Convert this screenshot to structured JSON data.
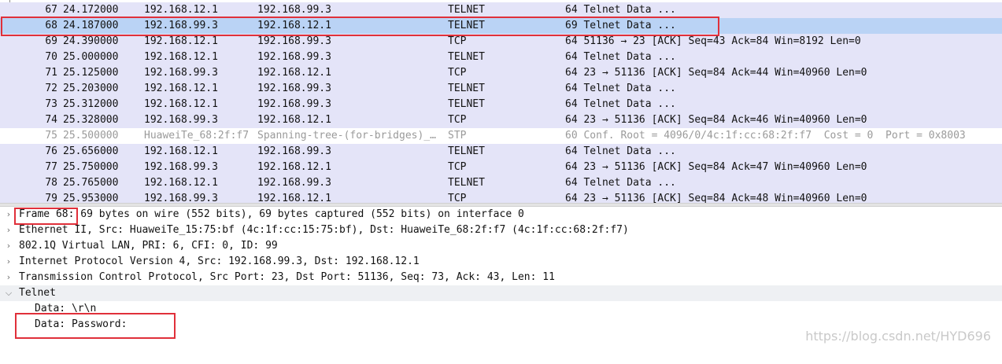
{
  "colors": {
    "row_telnet": "#e4e4f8",
    "row_tcp": "#e4e4f8",
    "row_stp": "#ffffff",
    "row_selected": "#bad3f5",
    "stp_text": "#9a9a9a",
    "highlight_box": "#e0303a"
  },
  "packets": [
    {
      "no": "67",
      "time": "24.172000",
      "src": "192.168.12.1",
      "dst": "192.168.99.3",
      "proto": "TELNET",
      "info": "64 Telnet Data ...",
      "kind": "telnet"
    },
    {
      "no": "68",
      "time": "24.187000",
      "src": "192.168.99.3",
      "dst": "192.168.12.1",
      "proto": "TELNET",
      "info": "69 Telnet Data ...",
      "kind": "selected"
    },
    {
      "no": "69",
      "time": "24.390000",
      "src": "192.168.12.1",
      "dst": "192.168.99.3",
      "proto": "TCP",
      "info": "64 51136 → 23 [ACK] Seq=43 Ack=84 Win=8192 Len=0",
      "kind": "tcp"
    },
    {
      "no": "70",
      "time": "25.000000",
      "src": "192.168.12.1",
      "dst": "192.168.99.3",
      "proto": "TELNET",
      "info": "64 Telnet Data ...",
      "kind": "telnet"
    },
    {
      "no": "71",
      "time": "25.125000",
      "src": "192.168.99.3",
      "dst": "192.168.12.1",
      "proto": "TCP",
      "info": "64 23 → 51136 [ACK] Seq=84 Ack=44 Win=40960 Len=0",
      "kind": "tcp"
    },
    {
      "no": "72",
      "time": "25.203000",
      "src": "192.168.12.1",
      "dst": "192.168.99.3",
      "proto": "TELNET",
      "info": "64 Telnet Data ...",
      "kind": "telnet"
    },
    {
      "no": "73",
      "time": "25.312000",
      "src": "192.168.12.1",
      "dst": "192.168.99.3",
      "proto": "TELNET",
      "info": "64 Telnet Data ...",
      "kind": "telnet"
    },
    {
      "no": "74",
      "time": "25.328000",
      "src": "192.168.99.3",
      "dst": "192.168.12.1",
      "proto": "TCP",
      "info": "64 23 → 51136 [ACK] Seq=84 Ack=46 Win=40960 Len=0",
      "kind": "tcp"
    },
    {
      "no": "75",
      "time": "25.500000",
      "src": "HuaweiTe_68:2f:f7",
      "dst": "Spanning-tree-(for-bridges)_…",
      "proto": "STP",
      "info": "60 Conf. Root = 4096/0/4c:1f:cc:68:2f:f7  Cost = 0  Port = 0x8003",
      "kind": "stp"
    },
    {
      "no": "76",
      "time": "25.656000",
      "src": "192.168.12.1",
      "dst": "192.168.99.3",
      "proto": "TELNET",
      "info": "64 Telnet Data ...",
      "kind": "telnet"
    },
    {
      "no": "77",
      "time": "25.750000",
      "src": "192.168.99.3",
      "dst": "192.168.12.1",
      "proto": "TCP",
      "info": "64 23 → 51136 [ACK] Seq=84 Ack=47 Win=40960 Len=0",
      "kind": "tcp"
    },
    {
      "no": "78",
      "time": "25.765000",
      "src": "192.168.12.1",
      "dst": "192.168.99.3",
      "proto": "TELNET",
      "info": "64 Telnet Data ...",
      "kind": "telnet"
    },
    {
      "no": "79",
      "time": "25.953000",
      "src": "192.168.99.3",
      "dst": "192.168.12.1",
      "proto": "TCP",
      "info": "64 23 → 51136 [ACK] Seq=84 Ack=48 Win=40960 Len=0",
      "kind": "tcp"
    }
  ],
  "details": {
    "frame_label": "Frame 68:",
    "frame_rest": " 69 bytes on wire (552 bits), 69 bytes captured (552 bits) on interface 0",
    "ethernet": "Ethernet II, Src: HuaweiTe_15:75:bf (4c:1f:cc:15:75:bf), Dst: HuaweiTe_68:2f:f7 (4c:1f:cc:68:2f:f7)",
    "vlan": "802.1Q Virtual LAN, PRI: 6, CFI: 0, ID: 99",
    "ip": "Internet Protocol Version 4, Src: 192.168.99.3, Dst: 192.168.12.1",
    "tcp": "Transmission Control Protocol, Src Port: 23, Dst Port: 51136, Seq: 73, Ack: 43, Len: 11",
    "telnet": "Telnet",
    "data1": "Data: \\r\\n",
    "data2": "Data: Password:"
  },
  "icons": {
    "collapsed": "chevron-right-icon",
    "expanded": "chevron-down-icon"
  },
  "watermark": "https://blog.csdn.net/HYD696"
}
